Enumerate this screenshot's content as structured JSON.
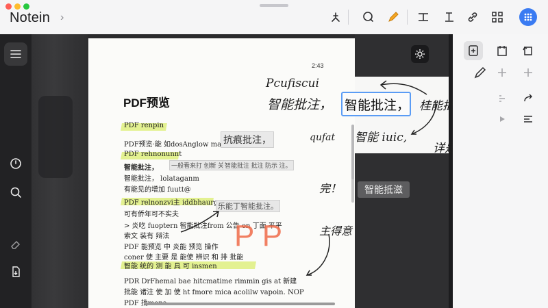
{
  "app": {
    "title": "Notein"
  },
  "page": {
    "time": "2:43",
    "title": "PDF预览",
    "lines": [
      "PDF renpin",
      "PDF预览·能 如dosAnglow mar",
      "PDF rehnonunnt",
      "智能批注，",
      "智能批注，  lolataganm",
      "有能见的增加 fuutt@",
      "PDF relnonzvi主 iddbhaurg",
      "可有侨年可不实夫",
      "> 炎吃 fuoptern 智能批注from 公告 on 丁面 平平 ",
      "索文 装有 辩法",
      "PDF 能预览 中 炎能 预览 操作",
      "coner 使 主要 是 能使 辨识 和 排 批能",
      "智能 统的 测 能 具 可 insmen",
      "PDR DrFhemal bae hitcmatime rimmin gis at 新建",
      "批能 诸注 使 加 使 ht fmore mica acolilw vapoin. NOP",
      "PDF 批mona"
    ],
    "chips": {
      "c1": "抗痕批注，",
      "c2": "智能批注，",
      "c3": "智能批注 批注 防示 注。",
      "c4": "乐能丁智能批注。",
      "c5": "一般看来打 创新 关于 注。"
    },
    "red_mark": "P P"
  },
  "annotations": {
    "hw1": "Pcufiscui",
    "hw2": "智能批注，",
    "selected": "智能批注，",
    "hw3": "桂能批注，",
    "hw4": "qufat",
    "hw5": "智能 iuic,",
    "hw6": "详是",
    "hw7": "完！",
    "hw8": "主得意",
    "badge": "智能抵滋"
  },
  "icons": {
    "toolbar": [
      "cursor-hand-icon",
      "lasso-icon",
      "pen-icon",
      "text-insert-icon",
      "text-note-icon",
      "link-icon",
      "grid-icon",
      "more-icon"
    ],
    "rail": [
      "outline-icon",
      "timer-icon",
      "search-replace-icon",
      "eraser-icon",
      "export-icon"
    ],
    "right_panel": [
      "page-insert-icon",
      "page-template-icon",
      "page-rotate-icon",
      "pen-tool-icon",
      "add-icon",
      "redo-icon",
      "align-icon"
    ]
  },
  "colors": {
    "accent": "#3a7bf2",
    "highlight": "#e3f191",
    "red_mark": "#f06b4a"
  }
}
